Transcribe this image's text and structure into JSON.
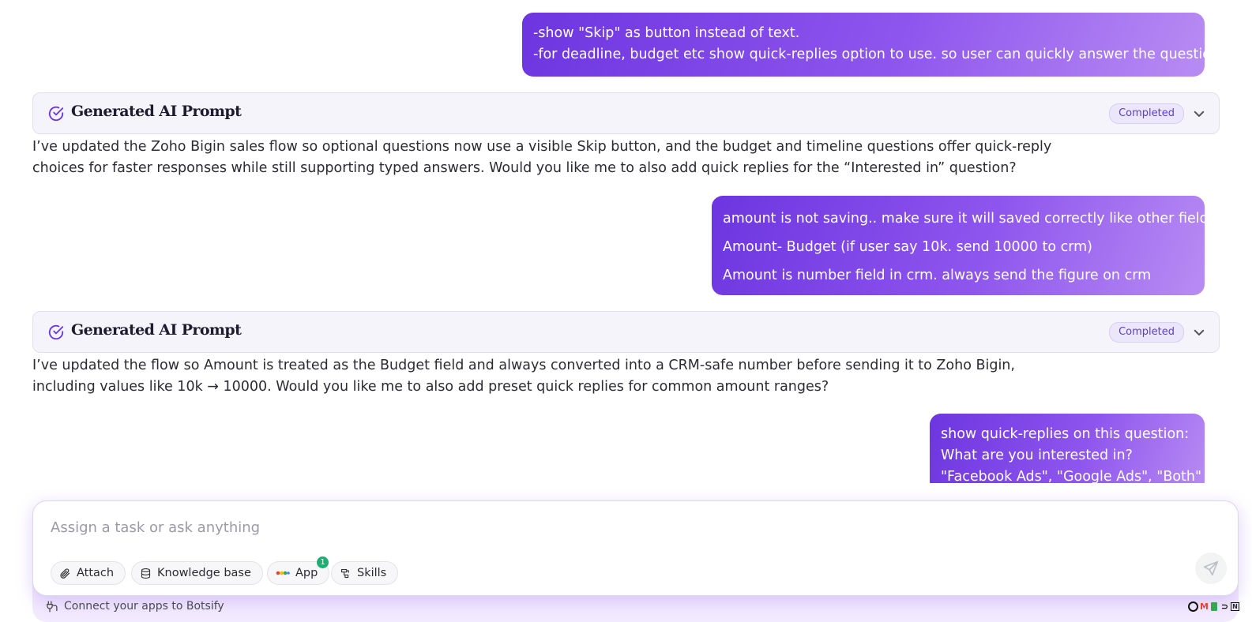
{
  "messages": {
    "user1": {
      "lines": [
        "-show \"Skip\" as button instead of text.",
        "-for deadline, budget etc show quick-replies option to use. so user can quickly answer the questions."
      ]
    },
    "prompt1": {
      "title": "Generated AI Prompt",
      "status": "Completed"
    },
    "ai1": {
      "lines": [
        "I’ve updated the Zoho Bigin sales flow so optional questions now use a visible Skip button, and the budget and timeline questions offer quick-reply",
        "choices for faster responses while still supporting typed answers. Would you like me to also add quick replies for the “Interested in” question?"
      ]
    },
    "user2": {
      "lines": [
        "amount is not saving.. make sure it will saved correctly like other fields.",
        "Amount- Budget (if user say 10k. send 10000 to crm)",
        "Amount is number field in crm. always send the figure on crm"
      ]
    },
    "prompt2": {
      "title": "Generated AI Prompt",
      "status": "Completed"
    },
    "ai2": {
      "lines": [
        "I’ve updated the flow so Amount is treated as the Budget field and always converted into a CRM-safe number before sending it to Zoho Bigin,",
        "including values like 10k → 10000. Would you like me to also add preset quick replies for common amount ranges?"
      ]
    },
    "user3": {
      "lines": [
        "show quick-replies on this question:",
        "What are you interested in?",
        "\"Facebook Ads\", \"Google Ads\", \"Both\""
      ]
    }
  },
  "composer": {
    "placeholder": "Assign a task or ask anything",
    "attach_label": "Attach",
    "knowledge_label": "Knowledge base",
    "app_label": "App",
    "app_count": "1",
    "skills_label": "Skills"
  },
  "footer": {
    "connect_text": "Connect your apps to Botsify"
  },
  "icons": {
    "check": "check-circle-icon",
    "chevron": "chevron-down-icon",
    "attach": "paperclip-icon",
    "knowledge": "database-icon",
    "app": "app-grid-icon",
    "skills": "skills-icon",
    "send": "send-icon",
    "connect": "plug-icon"
  },
  "colors": {
    "accent": "#6d35e0",
    "badge_text": "#5b3fc8",
    "count_badge": "#1fae72"
  }
}
